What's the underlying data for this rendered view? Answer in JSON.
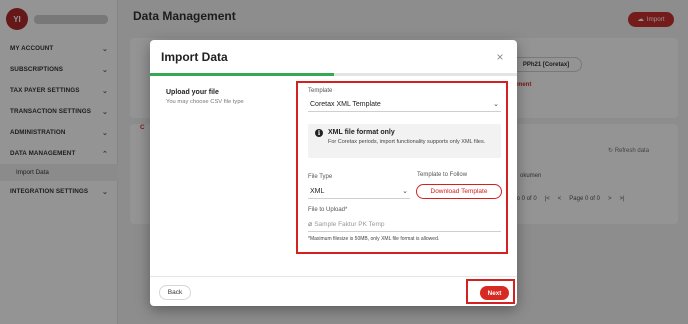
{
  "background": {
    "avatar_initials": "YI",
    "page_title": "Data Management",
    "import_button": "Import",
    "chip_text": "PPh21 [Coretax]",
    "red_link_text": "ment",
    "tab_label": "C",
    "refresh_text": "Refresh data",
    "dokumen_col": "okumen",
    "pager_count": "0 to 0 of 0",
    "pager_page": "Page 0 of 0",
    "nav": [
      {
        "label": "MY ACCOUNT",
        "chevron": "⌄"
      },
      {
        "label": "SUBSCRIPTIONS",
        "chevron": "⌄"
      },
      {
        "label": "TAX PAYER SETTINGS",
        "chevron": "⌄"
      },
      {
        "label": "TRANSACTION SETTINGS",
        "chevron": "⌄"
      },
      {
        "label": "ADMINISTRATION",
        "chevron": "⌄"
      },
      {
        "label": "DATA MANAGEMENT",
        "chevron": "⌃"
      },
      {
        "label": "Import Data",
        "sub": true
      },
      {
        "label": "INTEGRATION SETTINGS",
        "chevron": "⌄"
      }
    ]
  },
  "modal": {
    "title": "Import Data",
    "close_icon": "×",
    "progress_fraction": 0.5,
    "step": {
      "title": "Upload your file",
      "subtitle": "You may choose CSV file type"
    },
    "template": {
      "label": "Template",
      "value": "Coretax XML Template"
    },
    "info": {
      "icon": "i",
      "title": "XML file format only",
      "body": "For Coretax periods, import functionality supports only XML files."
    },
    "file_type": {
      "label": "File Type",
      "value": "XML"
    },
    "template_follow": {
      "label": "Template to Follow",
      "button": "Download Template"
    },
    "file_upload": {
      "label": "File to Upload*",
      "placeholder": "Sample Faktur PK Temp",
      "note": "*Maximum filesize is 50MB, only XML file format is allowed."
    },
    "back_button": "Back",
    "next_button": "Next"
  },
  "colors": {
    "accent_red": "#d32020",
    "progress_green": "#34a853"
  }
}
